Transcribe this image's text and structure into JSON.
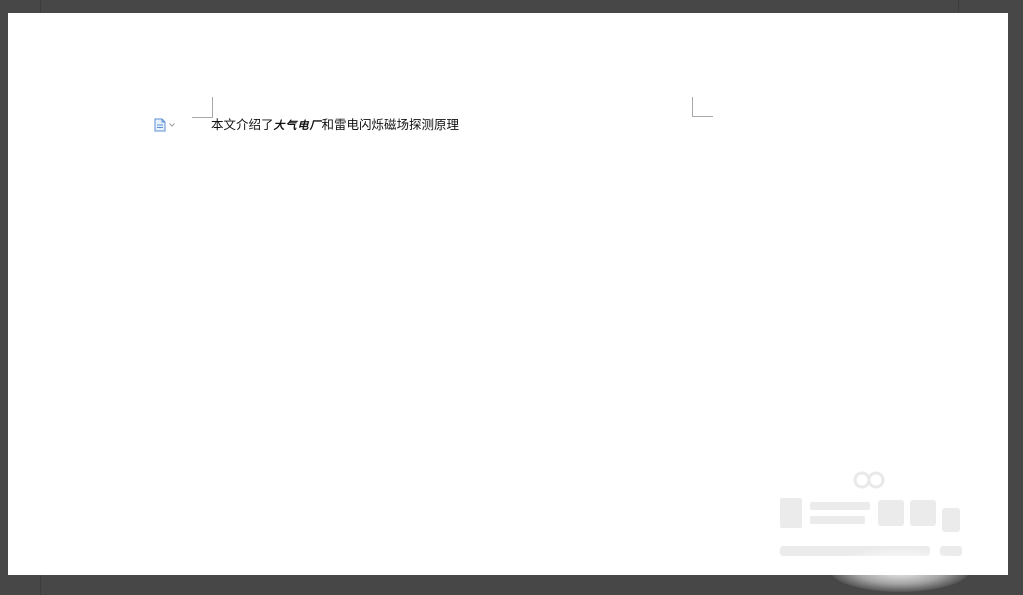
{
  "document": {
    "text_before": "本文介绍了",
    "text_styled": "大气电厂",
    "text_after": "和雷电闪烁磁场探测原理"
  },
  "paragraph_marker": {
    "icon": "document-icon",
    "dropdown_icon": "chevron-down-icon"
  },
  "watermark": {
    "icon": "baidu-jingyan-logo"
  },
  "colors": {
    "workspace_bg": "#474747",
    "page_bg": "#ffffff",
    "text": "#111111",
    "margin_guide": "#a8a8a8",
    "icon_accent": "#5b8fd6"
  }
}
